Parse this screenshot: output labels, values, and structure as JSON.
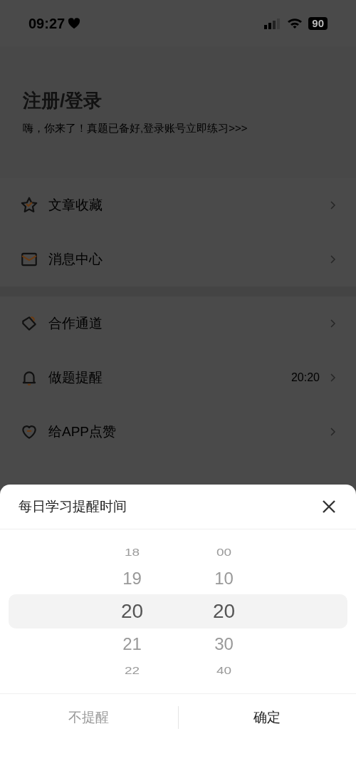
{
  "status_bar": {
    "time": "09:27",
    "battery": "90"
  },
  "header": {
    "title": "注册/登录",
    "subtitle": "嗨，你来了！真题已备好,登录账号立即练习>>>"
  },
  "menu_groups": [
    {
      "items": [
        {
          "kind": "star",
          "label": "文章收藏"
        },
        {
          "kind": "mail",
          "label": "消息中心"
        }
      ]
    },
    {
      "items": [
        {
          "kind": "tag",
          "label": "合作通道"
        },
        {
          "kind": "bell",
          "label": "做题提醒",
          "value": "20:20"
        },
        {
          "kind": "heart",
          "label": "给APP点赞"
        }
      ]
    }
  ],
  "sheet": {
    "title": "每日学习提醒时间",
    "hours": [
      {
        "label": "18",
        "selected": false
      },
      {
        "label": "19",
        "selected": false
      },
      {
        "label": "20",
        "selected": true
      },
      {
        "label": "21",
        "selected": false
      },
      {
        "label": "22",
        "selected": false
      }
    ],
    "minutes": [
      {
        "label": "00",
        "selected": false
      },
      {
        "label": "10",
        "selected": false
      },
      {
        "label": "20",
        "selected": true
      },
      {
        "label": "30",
        "selected": false
      },
      {
        "label": "40",
        "selected": false
      }
    ],
    "buttons": [
      {
        "kind": "secondary",
        "label": "不提醒"
      },
      {
        "kind": "primary",
        "label": "确定"
      }
    ]
  }
}
